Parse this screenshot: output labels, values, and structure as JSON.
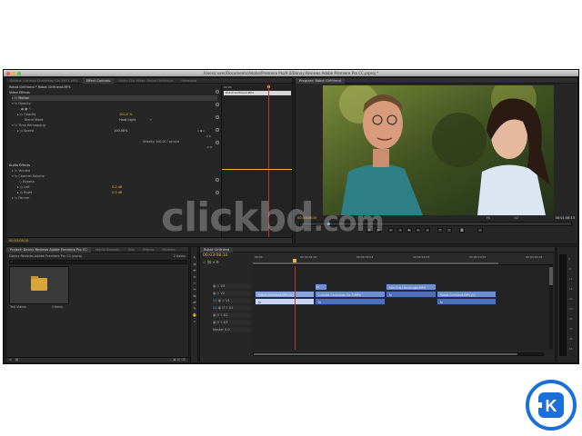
{
  "window": {
    "title": "/Users/ user/Documents/Adobe/Premiere Pro/9.0/Danny Reviews Adobe Premiere Pro CC.prproj *"
  },
  "source": {
    "tabs": [
      "Source: Lucinda Christmas Gin SHT1.MP4",
      "Effect Controls",
      "Audio Clip Mixer: Robot Girlfriend",
      "Metadata"
    ],
    "breadcrumb": "Robot Girlfriend * Robot Girlfriend.MP4",
    "mini_time": "00:00",
    "mini_clip": "Robot Girlfriend.MP4",
    "video_effects_label": "Video Effects",
    "rows": [
      {
        "name": "Motion",
        "value": ""
      },
      {
        "name": "Opacity",
        "value": ""
      },
      {
        "name": "Opacity",
        "value": "100.0 %"
      },
      {
        "name": "Blend Mode",
        "value": "Hard Light"
      },
      {
        "name": "Time Remapping",
        "value": ""
      },
      {
        "name": "Speed",
        "value": "100.00%"
      }
    ],
    "velocity": "Velocity: 100.00 / second",
    "speed_top": "0.0",
    "speed_bottom": "-0.0",
    "audio_effects_label": "Audio Effects",
    "audio_rows": [
      {
        "name": "Volume",
        "value": ""
      },
      {
        "name": "Channel Volume",
        "value": ""
      },
      {
        "name": "Bypass",
        "value": ""
      },
      {
        "name": "Left",
        "value": "0.0 dB"
      },
      {
        "name": "Right",
        "value": "0.0 dB"
      },
      {
        "name": "Panner",
        "value": ""
      }
    ],
    "timecode": "00:03:08:10"
  },
  "program": {
    "tab": "Program: Robot Girlfriend",
    "timecode_in": "00:03:08:10",
    "fit": "Fit",
    "quality": "1/2",
    "timecode_out": "00:01:08:13"
  },
  "project": {
    "tabs": [
      "Project: Danny Reviews Adobe Premiere Pro CC",
      "Media Browser",
      "Info",
      "Effects",
      "Markers"
    ],
    "file": "Danny Reviews Adobe Premiere Pro CC.prproj",
    "count": "2 Items",
    "bin_label": "Test Videos",
    "bin_count": "3 Items"
  },
  "timeline": {
    "tab": "Robot Girlfriend",
    "timecode": "00:03:08:10",
    "ruler": [
      "00:00",
      "00:00:04:16",
      "00:00:09:03",
      "00:00:14:03",
      "00:00:19:03",
      "00:00:24:03"
    ],
    "tracks": [
      "V3",
      "V2",
      "V1",
      "A1",
      "A2",
      "A3",
      "Master"
    ],
    "master_value": "0.0",
    "clips": [
      {
        "label": "Robot Girlfriend.MP4 [V]",
        "track": "V1"
      },
      {
        "label": "fx",
        "track": "V2"
      },
      {
        "label": "Lucinda Christmas Gin S.MP4",
        "track": "V1"
      },
      {
        "label": "Mini Eds Hamburger.MP4",
        "track": "V2"
      },
      {
        "label": "Robot Girlfriend.MP4 [V]",
        "track": "V1"
      }
    ]
  },
  "meters": [
    "0",
    "-6",
    "-12",
    "-18",
    "-24",
    "-30",
    "-36",
    "-42",
    "-48",
    "-54"
  ],
  "watermark": {
    "main": "clickbd",
    "suffix": ".com"
  },
  "colors": {
    "accent": "#e6b830",
    "clip_video": "#6f8fd0",
    "clip_audio": "#4f6fb8",
    "logo": "#1a6fd8"
  }
}
